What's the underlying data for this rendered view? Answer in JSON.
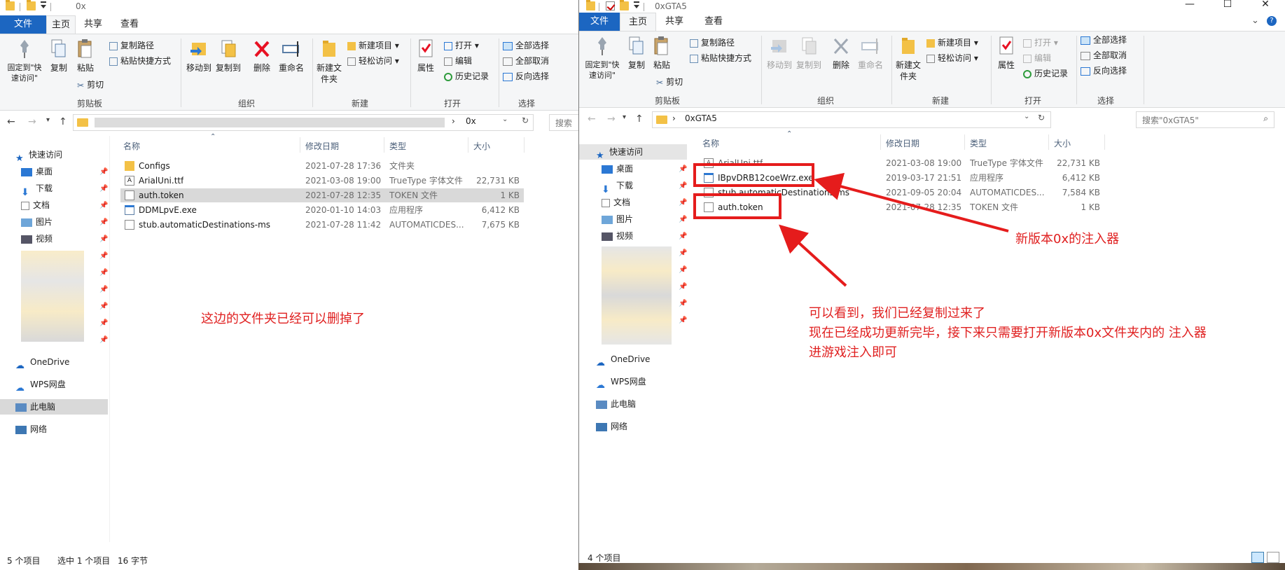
{
  "left_window": {
    "title": "0x",
    "tabs": [
      "文件",
      "主页",
      "共享",
      "查看"
    ],
    "ribbon": {
      "clipboard": {
        "pin": "固定到\"快速访问\"",
        "copy": "复制",
        "paste": "粘贴",
        "copy_path": "复制路径",
        "paste_shortcut": "粘贴快捷方式",
        "cut": "剪切",
        "group": "剪贴板"
      },
      "organize": {
        "move_to": "移动到",
        "copy_to": "复制到",
        "delete": "删除",
        "rename": "重命名",
        "group": "组织"
      },
      "new": {
        "new_folder": "新建文件夹",
        "new_item": "新建项目",
        "easy_access": "轻松访问",
        "group": "新建"
      },
      "open": {
        "properties": "属性",
        "open": "打开",
        "edit": "编辑",
        "history": "历史记录",
        "group": "打开"
      },
      "select": {
        "select_all": "全部选择",
        "select_none": "全部取消",
        "invert": "反向选择",
        "group": "选择"
      }
    },
    "address_path": "0x",
    "search_label": "搜索",
    "nav": {
      "quick_access": "快速访问",
      "items": [
        "桌面",
        "下载",
        "文档",
        "图片",
        "视频"
      ],
      "onedrive": "OneDrive",
      "wps": "WPS网盘",
      "this_pc": "此电脑",
      "network": "网络"
    },
    "columns": {
      "name": "名称",
      "date": "修改日期",
      "type": "类型",
      "size": "大小"
    },
    "files": [
      {
        "name": "Configs",
        "date": "2021-07-28 17:36",
        "type": "文件夹",
        "size": "",
        "icon": "folder-icon"
      },
      {
        "name": "ArialUni.ttf",
        "date": "2021-03-08 19:00",
        "type": "TrueType 字体文件",
        "size": "22,731 KB",
        "icon": "font-file-icon"
      },
      {
        "name": "auth.token",
        "date": "2021-07-28 12:35",
        "type": "TOKEN 文件",
        "size": "1 KB",
        "icon": "file-icon"
      },
      {
        "name": "DDMLpvE.exe",
        "date": "2020-01-10 14:03",
        "type": "应用程序",
        "size": "6,412 KB",
        "icon": "exe-icon"
      },
      {
        "name": "stub.automaticDestinations-ms",
        "date": "2021-07-28 11:42",
        "type": "AUTOMATICDES...",
        "size": "7,675 KB",
        "icon": "file-icon"
      }
    ],
    "status": {
      "count": "5 个项目",
      "selected": "选中 1 个项目",
      "bytes": "16 字节"
    },
    "annotation": "这边的文件夹已经可以删掉了"
  },
  "right_window": {
    "title": "0xGTA5",
    "tabs": [
      "文件",
      "主页",
      "共享",
      "查看"
    ],
    "ribbon": {
      "clipboard": {
        "pin": "固定到\"快速访问\"",
        "copy": "复制",
        "paste": "粘贴",
        "copy_path": "复制路径",
        "paste_shortcut": "粘贴快捷方式",
        "cut": "剪切",
        "group": "剪贴板"
      },
      "organize": {
        "move_to": "移动到",
        "copy_to": "复制到",
        "delete": "删除",
        "rename": "重命名",
        "group": "组织"
      },
      "new": {
        "new_folder": "新建文件夹",
        "new_item": "新建项目",
        "easy_access": "轻松访问",
        "group": "新建"
      },
      "open": {
        "properties": "属性",
        "open": "打开",
        "edit": "编辑",
        "history": "历史记录",
        "group": "打开"
      },
      "select": {
        "select_all": "全部选择",
        "select_none": "全部取消",
        "invert": "反向选择",
        "group": "选择"
      }
    },
    "address_path": "0xGTA5",
    "search_placeholder": "搜索\"0xGTA5\"",
    "nav": {
      "quick_access": "快速访问",
      "items": [
        "桌面",
        "下载",
        "文档",
        "图片",
        "视频"
      ],
      "onedrive": "OneDrive",
      "wps": "WPS网盘",
      "this_pc": "此电脑",
      "network": "网络"
    },
    "columns": {
      "name": "名称",
      "date": "修改日期",
      "type": "类型",
      "size": "大小"
    },
    "files": [
      {
        "name": "ArialUni.ttf",
        "date": "2021-03-08 19:00",
        "type": "TrueType 字体文件",
        "size": "22,731 KB",
        "icon": "font-file-icon"
      },
      {
        "name": "IBpvDRB12coeWrz.exe",
        "date": "2019-03-17 21:51",
        "type": "应用程序",
        "size": "6,412 KB",
        "icon": "exe-icon"
      },
      {
        "name": "stub.automaticDestinations-ms",
        "date": "2021-09-05 20:04",
        "type": "AUTOMATICDES...",
        "size": "7,584 KB",
        "icon": "file-icon"
      },
      {
        "name": "auth.token",
        "date": "2021-07-28 12:35",
        "type": "TOKEN 文件",
        "size": "1 KB",
        "icon": "file-icon"
      }
    ],
    "status": {
      "count": "4 个项目"
    },
    "annotation_injector": "新版本0x的注入器",
    "annotation_lines": [
      "可以看到，我们已经复制过来了",
      "现在已经成功更新完毕，接下来只需要打开新版本0x文件夹内的 注入器",
      "进游戏注入即可"
    ]
  },
  "colors": {
    "accent": "#1c66c1",
    "annotation": "#e02020",
    "selection": "#d9d9d9",
    "folder": "#f3c146"
  }
}
